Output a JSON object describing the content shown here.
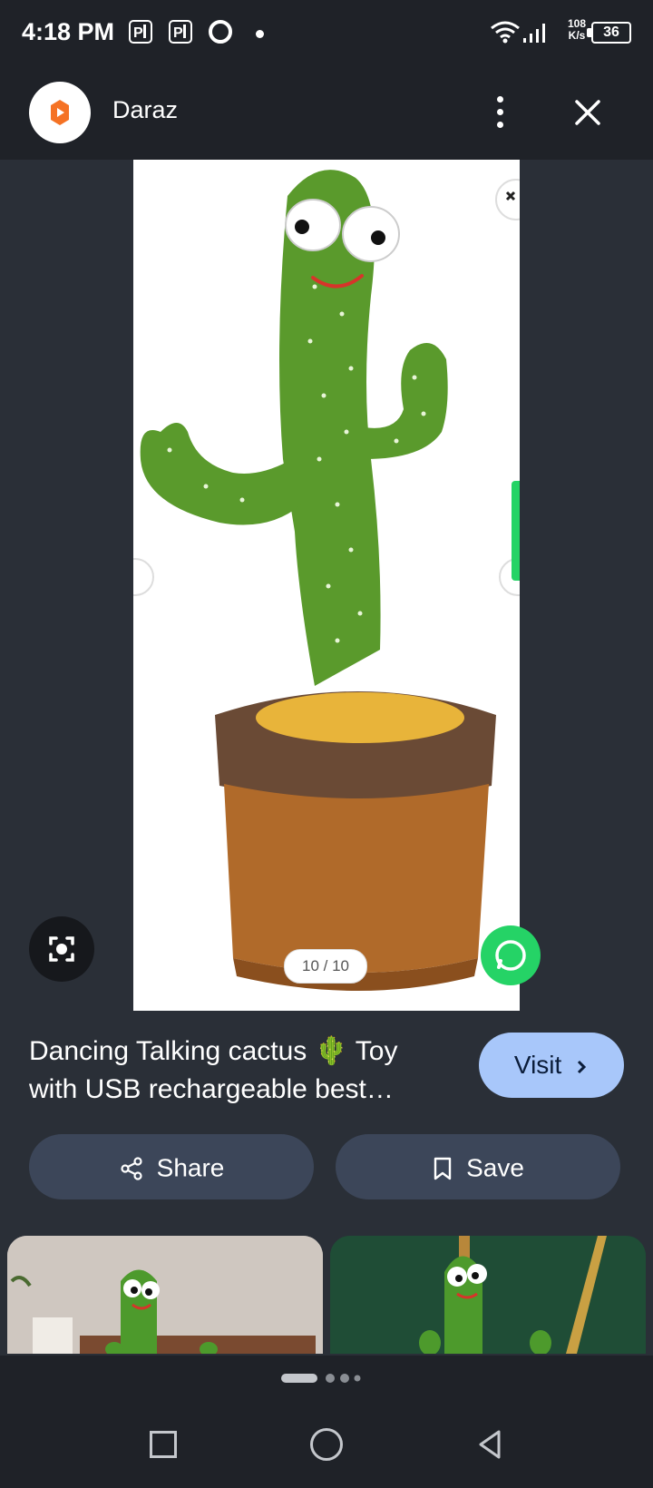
{
  "status_bar": {
    "time": "4:18 PM",
    "net_speed_value": "108",
    "net_speed_unit": "K/s",
    "battery": "36",
    "icons": [
      "parking-icon",
      "parking-icon",
      "sync-icon",
      "notification-dot",
      "wifi-icon",
      "signal-icon",
      "battery-icon"
    ]
  },
  "header": {
    "app_name": "Daraz",
    "logo_icon": "daraz-logo-icon",
    "menu_icon": "more-vert-icon",
    "close_icon": "close-icon"
  },
  "image_viewer": {
    "counter": "10 / 10",
    "image_subject": "dancing cactus toy in brown pot",
    "lens_icon": "google-lens-icon",
    "whatsapp_icon": "whatsapp-icon"
  },
  "result": {
    "title_line1": "Dancing Talking cactus 🌵 Toy",
    "title_line2": "with USB rechargeable best…",
    "visit_label": "Visit"
  },
  "actions": {
    "share_label": "Share",
    "save_label": "Save"
  },
  "pager": {
    "total": 4,
    "active": 1
  },
  "colors": {
    "background": "#2a2f37",
    "bar": "#1f2228",
    "visit": "#a8c7fa",
    "action": "#3c4659",
    "whatsapp": "#25d366",
    "daraz": "#f57224"
  }
}
